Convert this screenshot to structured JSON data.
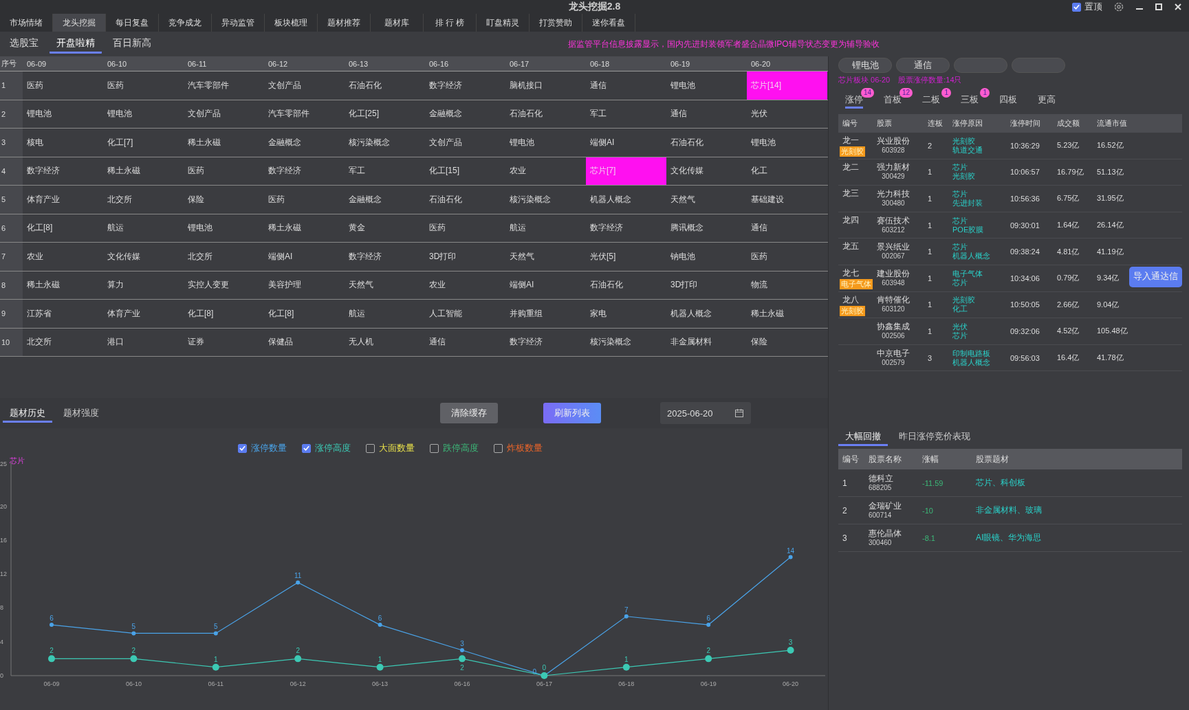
{
  "window": {
    "title": "龙头挖掘2.8",
    "pin": {
      "label": "置顶",
      "checked": true
    }
  },
  "main_tabs": [
    {
      "label": "市场情绪",
      "selected": false
    },
    {
      "label": "龙头挖掘",
      "selected": true
    },
    {
      "label": "每日复盘",
      "selected": false
    },
    {
      "label": "竞争成龙",
      "selected": false
    },
    {
      "label": "异动监管",
      "selected": false
    },
    {
      "label": "板块梳理",
      "selected": false
    },
    {
      "label": "题材推荐",
      "selected": false
    },
    {
      "label": "题材库",
      "selected": false
    },
    {
      "label": "排 行 榜",
      "selected": false
    },
    {
      "label": "盯盘精灵",
      "selected": false
    },
    {
      "label": "打赏赞助",
      "selected": false
    },
    {
      "label": "迷你看盘",
      "selected": false
    }
  ],
  "sub_tabs": [
    {
      "label": "选股宝",
      "selected": false
    },
    {
      "label": "开盘啦精",
      "selected": true
    },
    {
      "label": "百日新高",
      "selected": false
    }
  ],
  "notice": "据监管平台信息披露显示，国内先进封装领军者盛合晶微IPO辅导状态变更为辅导验收",
  "theme_table": {
    "index_header": "序号",
    "columns": [
      "06-09",
      "06-10",
      "06-11",
      "06-12",
      "06-13",
      "06-16",
      "06-17",
      "06-18",
      "06-19",
      "06-20"
    ],
    "rows": [
      {
        "index": "1",
        "cells": [
          {
            "text": "医药",
            "highlighted": false
          },
          {
            "text": "医药",
            "highlighted": false
          },
          {
            "text": "汽车零部件",
            "highlighted": false
          },
          {
            "text": "文创产品",
            "highlighted": false
          },
          {
            "text": "石油石化",
            "highlighted": false
          },
          {
            "text": "数字经济",
            "highlighted": false
          },
          {
            "text": "脑机接口",
            "highlighted": false
          },
          {
            "text": "通信",
            "highlighted": false
          },
          {
            "text": "锂电池",
            "highlighted": false
          },
          {
            "text": "芯片[14]",
            "highlighted": true
          }
        ]
      },
      {
        "index": "2",
        "cells": [
          {
            "text": "锂电池",
            "highlighted": false
          },
          {
            "text": "锂电池",
            "highlighted": false
          },
          {
            "text": "文创产品",
            "highlighted": false
          },
          {
            "text": "汽车零部件",
            "highlighted": false
          },
          {
            "text": "化工[25]",
            "highlighted": false
          },
          {
            "text": "金融概念",
            "highlighted": false
          },
          {
            "text": "石油石化",
            "highlighted": false
          },
          {
            "text": "军工",
            "highlighted": false
          },
          {
            "text": "通信",
            "highlighted": false
          },
          {
            "text": "光伏",
            "highlighted": false
          }
        ]
      },
      {
        "index": "3",
        "cells": [
          {
            "text": "核电",
            "highlighted": false
          },
          {
            "text": "化工[7]",
            "highlighted": false
          },
          {
            "text": "稀土永磁",
            "highlighted": false
          },
          {
            "text": "金融概念",
            "highlighted": false
          },
          {
            "text": "核污染概念",
            "highlighted": false
          },
          {
            "text": "文创产品",
            "highlighted": false
          },
          {
            "text": "锂电池",
            "highlighted": false
          },
          {
            "text": "端侧AI",
            "highlighted": false
          },
          {
            "text": "石油石化",
            "highlighted": false
          },
          {
            "text": "锂电池",
            "highlighted": false
          }
        ]
      },
      {
        "index": "4",
        "cells": [
          {
            "text": "数字经济",
            "highlighted": false
          },
          {
            "text": "稀土永磁",
            "highlighted": false
          },
          {
            "text": "医药",
            "highlighted": false
          },
          {
            "text": "数字经济",
            "highlighted": false
          },
          {
            "text": "军工",
            "highlighted": false
          },
          {
            "text": "化工[15]",
            "highlighted": false
          },
          {
            "text": "农业",
            "highlighted": false
          },
          {
            "text": "芯片[7]",
            "highlighted": true
          },
          {
            "text": "文化传媒",
            "highlighted": false
          },
          {
            "text": "化工",
            "highlighted": false
          }
        ]
      },
      {
        "index": "5",
        "cells": [
          {
            "text": "体育产业",
            "highlighted": false
          },
          {
            "text": "北交所",
            "highlighted": false
          },
          {
            "text": "保险",
            "highlighted": false
          },
          {
            "text": "医药",
            "highlighted": false
          },
          {
            "text": "金融概念",
            "highlighted": false
          },
          {
            "text": "石油石化",
            "highlighted": false
          },
          {
            "text": "核污染概念",
            "highlighted": false
          },
          {
            "text": "机器人概念",
            "highlighted": false
          },
          {
            "text": "天然气",
            "highlighted": false
          },
          {
            "text": "基础建设",
            "highlighted": false
          }
        ]
      },
      {
        "index": "6",
        "cells": [
          {
            "text": "化工[8]",
            "highlighted": false
          },
          {
            "text": "航运",
            "highlighted": false
          },
          {
            "text": "锂电池",
            "highlighted": false
          },
          {
            "text": "稀土永磁",
            "highlighted": false
          },
          {
            "text": "黄金",
            "highlighted": false
          },
          {
            "text": "医药",
            "highlighted": false
          },
          {
            "text": "航运",
            "highlighted": false
          },
          {
            "text": "数字经济",
            "highlighted": false
          },
          {
            "text": "腾讯概念",
            "highlighted": false
          },
          {
            "text": "通信",
            "highlighted": false
          }
        ]
      },
      {
        "index": "7",
        "cells": [
          {
            "text": "农业",
            "highlighted": false
          },
          {
            "text": "文化传媒",
            "highlighted": false
          },
          {
            "text": "北交所",
            "highlighted": false
          },
          {
            "text": "端侧AI",
            "highlighted": false
          },
          {
            "text": "数字经济",
            "highlighted": false
          },
          {
            "text": "3D打印",
            "highlighted": false
          },
          {
            "text": "天然气",
            "highlighted": false
          },
          {
            "text": "光伏[5]",
            "highlighted": false
          },
          {
            "text": "钠电池",
            "highlighted": false
          },
          {
            "text": "医药",
            "highlighted": false
          }
        ]
      },
      {
        "index": "8",
        "cells": [
          {
            "text": "稀土永磁",
            "highlighted": false
          },
          {
            "text": "算力",
            "highlighted": false
          },
          {
            "text": "实控人变更",
            "highlighted": false
          },
          {
            "text": "美容护理",
            "highlighted": false
          },
          {
            "text": "天然气",
            "highlighted": false
          },
          {
            "text": "农业",
            "highlighted": false
          },
          {
            "text": "端侧AI",
            "highlighted": false
          },
          {
            "text": "石油石化",
            "highlighted": false
          },
          {
            "text": "3D打印",
            "highlighted": false
          },
          {
            "text": "物流",
            "highlighted": false
          }
        ]
      },
      {
        "index": "9",
        "cells": [
          {
            "text": "江苏省",
            "highlighted": false
          },
          {
            "text": "体育产业",
            "highlighted": false
          },
          {
            "text": "化工[8]",
            "highlighted": false
          },
          {
            "text": "化工[8]",
            "highlighted": false
          },
          {
            "text": "航运",
            "highlighted": false
          },
          {
            "text": "人工智能",
            "highlighted": false
          },
          {
            "text": "并购重组",
            "highlighted": false
          },
          {
            "text": "家电",
            "highlighted": false
          },
          {
            "text": "机器人概念",
            "highlighted": false
          },
          {
            "text": "稀土永磁",
            "highlighted": false
          }
        ]
      },
      {
        "index": "10",
        "cells": [
          {
            "text": "北交所",
            "highlighted": false
          },
          {
            "text": "港口",
            "highlighted": false
          },
          {
            "text": "证券",
            "highlighted": false
          },
          {
            "text": "保健品",
            "highlighted": false
          },
          {
            "text": "无人机",
            "highlighted": false
          },
          {
            "text": "通信",
            "highlighted": false
          },
          {
            "text": "数字经济",
            "highlighted": false
          },
          {
            "text": "核污染概念",
            "highlighted": false
          },
          {
            "text": "非金属材料",
            "highlighted": false
          },
          {
            "text": "保险",
            "highlighted": false
          }
        ]
      }
    ]
  },
  "history_panel": {
    "tabs": [
      {
        "label": "题材历史",
        "selected": true
      },
      {
        "label": "题材强度",
        "selected": false
      }
    ],
    "buttons": [
      {
        "label": "清除缓存",
        "kind": "secondary"
      },
      {
        "label": "刷新列表",
        "kind": "primary"
      }
    ],
    "date": "2025-06-20",
    "legend": [
      {
        "kind": "series",
        "checked": true
      },
      {
        "kind": "series",
        "checked": true
      },
      {
        "kind": "extra",
        "label": "大面数量",
        "checked": false,
        "color": "#e8e04a"
      },
      {
        "kind": "extra",
        "label": "跌停高度",
        "checked": false,
        "color": "#3cb878"
      },
      {
        "kind": "extra",
        "label": "炸板数量",
        "checked": false,
        "color": "#e8642a"
      }
    ],
    "chart_label": "芯片",
    "chart_data": {
      "type": "line",
      "categories": [
        "06-09",
        "06-10",
        "06-11",
        "06-12",
        "06-13",
        "06-16",
        "06-17",
        "06-18",
        "06-19",
        "06-20"
      ],
      "series": [
        {
          "name": "涨停数量",
          "color": "#4aa3e8",
          "marker": "circle",
          "values": [
            6,
            5,
            5,
            11,
            6,
            3,
            0,
            7,
            6,
            14
          ]
        },
        {
          "name": "涨停高度",
          "color": "#3cc9b4",
          "marker": "circle",
          "values": [
            2,
            2,
            1,
            2,
            1,
            2,
            0,
            1,
            2,
            3
          ]
        }
      ],
      "ylim": [
        0,
        25
      ],
      "yticks": [
        0,
        4,
        8,
        12,
        16,
        20,
        25
      ],
      "data_labels": true
    }
  },
  "sector_panel": {
    "chips": [
      {
        "kind": "label",
        "label": "锂电池"
      },
      {
        "kind": "label",
        "label": "通信"
      },
      {
        "kind": "empty"
      },
      {
        "kind": "empty"
      }
    ],
    "info": [
      "芯片板块 06-20",
      "股票涨停数量:14只"
    ],
    "tabs": [
      {
        "label": "涨停",
        "badge": "14",
        "selected": true
      },
      {
        "label": "首板",
        "badge": "12",
        "selected": false
      },
      {
        "label": "二板",
        "badge": "1",
        "selected": false
      },
      {
        "label": "三板",
        "badge": "1",
        "selected": false
      },
      {
        "label": "四板",
        "selected": false
      },
      {
        "label": "更高",
        "selected": false
      }
    ],
    "columns": [
      "编号",
      "股票",
      "连板",
      "涨停原因",
      "涨停时间",
      "成交额",
      "流通市值"
    ],
    "rows": [
      {
        "rank": "龙一",
        "tag": "光刻胶",
        "name": "兴业股份",
        "code": "603928",
        "boards": "2",
        "reasons": [
          "光刻胶",
          "轨道交通"
        ],
        "time": "10:36:29",
        "amount": "5.23亿",
        "cap": "16.52亿"
      },
      {
        "rank": "龙二",
        "name": "强力新材",
        "code": "300429",
        "boards": "1",
        "reasons": [
          "芯片",
          "光刻胶"
        ],
        "time": "10:06:57",
        "amount": "16.79亿",
        "cap": "51.13亿"
      },
      {
        "rank": "龙三",
        "name": "光力科技",
        "code": "300480",
        "boards": "1",
        "reasons": [
          "芯片",
          "先进封装"
        ],
        "time": "10:56:36",
        "amount": "6.75亿",
        "cap": "31.95亿"
      },
      {
        "rank": "龙四",
        "name": "赛伍技术",
        "code": "603212",
        "boards": "1",
        "reasons": [
          "芯片",
          "POE胶膜"
        ],
        "time": "09:30:01",
        "amount": "1.64亿",
        "cap": "26.14亿"
      },
      {
        "rank": "龙五",
        "name": "景兴纸业",
        "code": "002067",
        "boards": "1",
        "reasons": [
          "芯片",
          "机器人概念"
        ],
        "time": "09:38:24",
        "amount": "4.81亿",
        "cap": "41.19亿"
      },
      {
        "rank": "龙七",
        "tag": "电子气体",
        "name": "建业股份",
        "code": "603948",
        "boards": "1",
        "reasons": [
          "电子气体",
          "芯片"
        ],
        "time": "10:34:06",
        "amount": "0.79亿",
        "cap": "9.34亿"
      },
      {
        "rank": "龙八",
        "tag": "光刻胶",
        "name": "肯特催化",
        "code": "603120",
        "boards": "1",
        "reasons": [
          "光刻胶",
          "化工"
        ],
        "time": "10:50:05",
        "amount": "2.66亿",
        "cap": "9.04亿"
      },
      {
        "name": "协鑫集成",
        "code": "002506",
        "boards": "1",
        "reasons": [
          "光伏",
          "芯片"
        ],
        "time": "09:32:06",
        "amount": "4.52亿",
        "cap": "105.48亿"
      },
      {
        "name": "中京电子",
        "code": "002579",
        "boards": "3",
        "reasons": [
          "印制电路板",
          "机器人概念"
        ],
        "time": "09:56:03",
        "amount": "16.4亿",
        "cap": "41.78亿"
      }
    ],
    "import_button": "导入通达信"
  },
  "pullback_panel": {
    "tabs": [
      {
        "label": "大幅回撤",
        "selected": true
      },
      {
        "label": "昨日涨停竞价表现",
        "selected": false
      }
    ],
    "columns": [
      "编号",
      "股票名称",
      "涨幅",
      "股票题材"
    ],
    "rows": [
      {
        "index": "1",
        "name": "德科立",
        "code": "688205",
        "change": "-11.59",
        "themes": "芯片、科创板"
      },
      {
        "index": "2",
        "name": "金瑞矿业",
        "code": "600714",
        "change": "-10",
        "themes": "非金属材料、玻璃"
      },
      {
        "index": "3",
        "name": "惠伦晶体",
        "code": "300460",
        "change": "-8.1",
        "themes": "AI眼镜、华为海思"
      }
    ]
  }
}
